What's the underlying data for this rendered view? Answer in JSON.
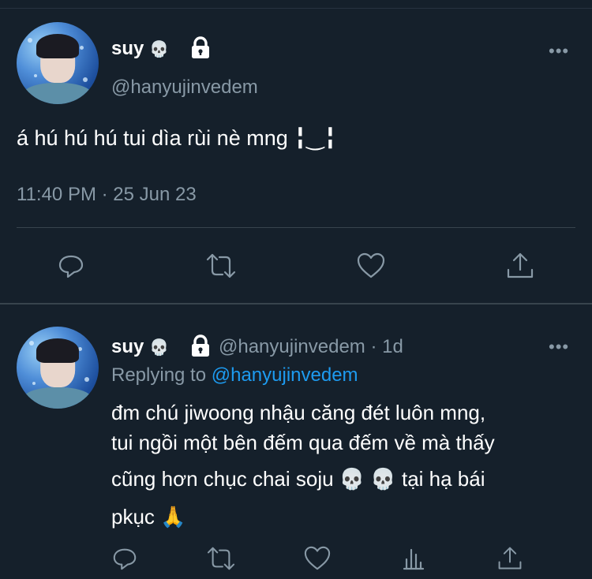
{
  "main_tweet": {
    "display_name": "suy",
    "name_emoji": "💀",
    "lock_icon": "lock-icon",
    "handle": "@hanyujinvedem",
    "text": "á hú hú hú tui dìa rùi nè mng ╏‿╏",
    "time": "11:40 PM",
    "date_sep": "·",
    "date": "25 Jun 23",
    "more": "•••"
  },
  "reply_tweet": {
    "display_name": "suy",
    "name_emoji": "💀",
    "handle": "@hanyujinvedem",
    "time_sep": "·",
    "age": "1d",
    "replying_to_label": "Replying to",
    "replying_to_handle": "@hanyujinvedem",
    "lines": [
      "đm chú jiwoong nhậu căng đét luôn mng,",
      "tui ngồi một bên đếm qua đếm về mà thấy",
      "cũng hơn chục chai soju 💀 💀  tại hạ bái",
      "pkục 🙏"
    ],
    "more": "•••"
  },
  "icons": [
    "reply-icon",
    "retweet-icon",
    "like-icon",
    "share-icon",
    "analytics-icon",
    "more-icon",
    "lock-icon"
  ],
  "colors": {
    "background": "#15202b",
    "muted": "#8899a6",
    "link": "#1d9bf0",
    "divider": "#38444d"
  }
}
